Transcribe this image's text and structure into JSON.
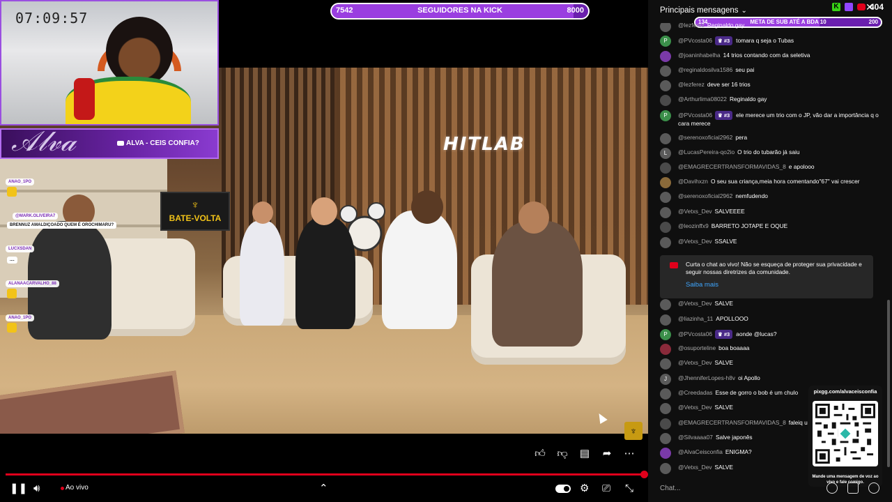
{
  "video": {
    "clock": "07:09:57",
    "banner_text": "ALVA - CEIS CONFIA?",
    "hitlab_sign": "HITLAB",
    "bate_volta": "BATE-VOLTA",
    "overlay_chat": [
      {
        "name": "ANAO_1PO",
        "message": ""
      },
      {
        "name": "@MARK.OLIVEIRA7",
        "message": "BRENNUZ AMALDIÇOADO QUEM É OROCHIMARU?"
      },
      {
        "name": "LUCXSDAN",
        "message": "...."
      },
      {
        "name": "ALANAACARVALHO_88",
        "message": ""
      },
      {
        "name": "ANAO_1PO",
        "message": ""
      }
    ],
    "follow_goal": {
      "current": "7542",
      "label": "SEGUIDORES NA KICK",
      "target": "8000",
      "progress": 0.9428
    },
    "live_label": "Ao vivo",
    "progress": 0.995
  },
  "chat": {
    "title": "Principais mensagens",
    "viewer_count": "404",
    "sub_goal": {
      "current": "134",
      "label": "META DE SUB ATÉ A BDA 10",
      "target": "200",
      "progress": 0.67
    },
    "messages": [
      {
        "user": "@lezferez",
        "badge": "",
        "text": "Reginaldo gay",
        "avatar": ""
      },
      {
        "user": "@PVcosta06",
        "badge": "♛ #3",
        "text": "tomara q seja o Tubas",
        "avatar": "P"
      },
      {
        "user": "@joaninhabelha",
        "badge": "",
        "text": "14 trios contando com da seletiva",
        "avatar": ""
      },
      {
        "user": "@reginaldosilva1586",
        "badge": "",
        "text": "seu pai",
        "avatar": ""
      },
      {
        "user": "@lezferez",
        "badge": "",
        "text": "deve ser 16 trios",
        "avatar": ""
      },
      {
        "user": "@Arthurlima08022",
        "badge": "",
        "text": "Reginaldo gay",
        "avatar": ""
      },
      {
        "user": "@PVcosta06",
        "badge": "♛ #3",
        "text": "ele merece um trio com o JP, vão dar a importância q o cara merece",
        "avatar": "P"
      },
      {
        "user": "@serenoxoficial2962",
        "badge": "",
        "text": "pera",
        "avatar": ""
      },
      {
        "user": "@LucasPereira-qo2io",
        "badge": "",
        "text": "O trio do tubarão já saiu",
        "avatar": "L"
      },
      {
        "user": "@EMAGRECERTRANSFORMAVIDAS_8",
        "badge": "",
        "text": "e apolooo",
        "avatar": ""
      },
      {
        "user": "@Davihxzn",
        "badge": "",
        "text": "O seu sua criança,meia hora comentando\"67\" vai crescer",
        "avatar": ""
      },
      {
        "user": "@serenoxoficial2962",
        "badge": "",
        "text": "nemfudendo",
        "avatar": ""
      },
      {
        "user": "@Vetxs_Dev",
        "badge": "",
        "text": "SALVEEEE",
        "avatar": ""
      },
      {
        "user": "@leozinffx9",
        "badge": "",
        "text": "BARRETO JOTAPE E OQUE",
        "avatar": ""
      },
      {
        "user": "@Vetxs_Dev",
        "badge": "",
        "text": "SSALVE",
        "avatar": ""
      },
      {
        "user": "@Vetxs_Dev",
        "badge": "",
        "text": "SALVE",
        "avatar": ""
      },
      {
        "user": "@liazinha_11",
        "badge": "",
        "text": "APOLLOOO",
        "avatar": ""
      },
      {
        "user": "@PVcosta06",
        "badge": "♛ #3",
        "text": "aonde @lucas?",
        "avatar": "P"
      },
      {
        "user": "@osuporteline",
        "badge": "",
        "text": "boa boaaaa",
        "avatar": ""
      },
      {
        "user": "@Vetxs_Dev",
        "badge": "",
        "text": "SALVE",
        "avatar": ""
      },
      {
        "user": "@JhenniferLopes-h8v",
        "badge": "",
        "text": "oi Apollo",
        "avatar": "J"
      },
      {
        "user": "@Creedadas",
        "badge": "",
        "text": "Esse de gorro o bob é um chulo",
        "avatar": ""
      },
      {
        "user": "@Vetxs_Dev",
        "badge": "",
        "text": "SALVE",
        "avatar": ""
      },
      {
        "user": "@EMAGRECERTRANSFORMAVIDAS_8",
        "badge": "",
        "text": "faleiq u",
        "avatar": ""
      },
      {
        "user": "@Silvaaaa07",
        "badge": "",
        "text": "Salve japonês",
        "avatar": ""
      },
      {
        "user": "@AlvaCeisconfia",
        "badge": "",
        "text": "ENIGMA?",
        "avatar": ""
      },
      {
        "user": "@Vetxs_Dev",
        "badge": "",
        "text": "SALVE",
        "avatar": ""
      }
    ],
    "notice": {
      "text": "Curta o chat ao vivo! Não se esqueça de proteger sua privacidade e seguir nossas diretrizes da comunidade.",
      "link": "Saiba mais"
    },
    "pix": {
      "url": "pixgg.com/alvaceisconfia",
      "caption": "Mande uma mensagem de voz ao vivo e fale comigo."
    },
    "input_placeholder": "Chat..."
  },
  "colors": {
    "accent_purple": "#6a1fae",
    "live_red": "#e0001b",
    "kick_green": "#38d316"
  }
}
